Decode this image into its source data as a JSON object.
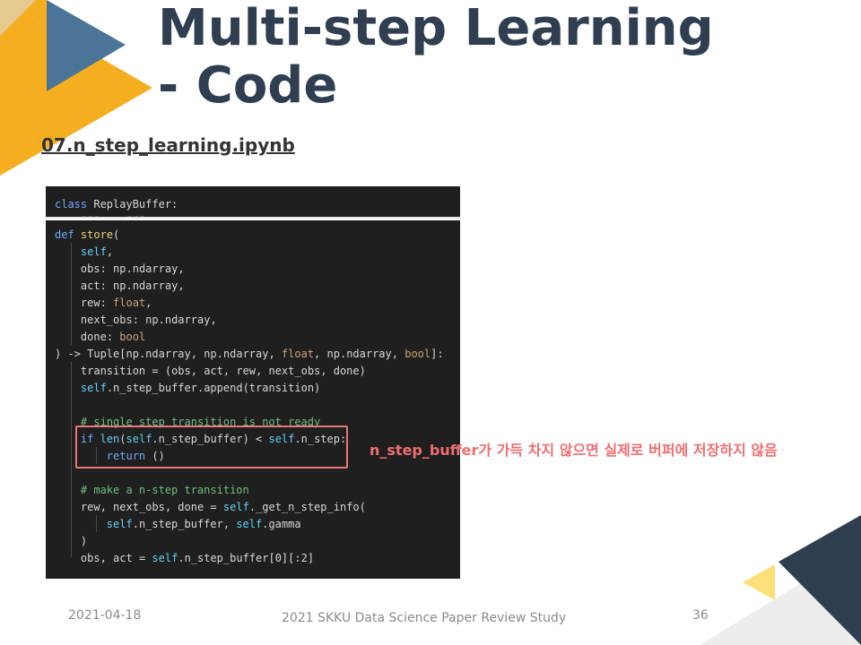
{
  "slide": {
    "title_line1": "Multi-step Learning",
    "title_line2": "- Code",
    "subtitle": "07.n_step_learning.ipynb",
    "annotation": "n_step_buffer가 가득 차지 않으면 실제로 버퍼에 저장하지 않음",
    "footer": {
      "date": "2021-04-18",
      "study": "2021 SKKU Data Science Paper Review Study",
      "page": "36"
    },
    "colors": {
      "title": "#2f3e51",
      "accent_yellow": "#f5ae1f",
      "accent_blue": "#4a7598",
      "dark_navy": "#2f3e51",
      "light_yellow": "#fde07a",
      "highlight": "#ee6e70"
    }
  },
  "code": {
    "class_line": "class ReplayBuffer:",
    "lines": [
      "def store(",
      "    self,",
      "    obs: np.ndarray,",
      "    act: np.ndarray,",
      "    rew: float,",
      "    next_obs: np.ndarray,",
      "    done: bool",
      ") -> Tuple[np.ndarray, np.ndarray, float, np.ndarray, bool]:",
      "    transition = (obs, act, rew, next_obs, done)",
      "    self.n_step_buffer.append(transition)",
      "",
      "    # single step transition is not ready",
      "    if len(self.n_step_buffer) < self.n_step:",
      "        return ()",
      "",
      "    # make a n-step transition",
      "    rew, next_obs, done = self._get_n_step_info(",
      "        self.n_step_buffer, self.gamma",
      "    )",
      "    obs, act = self.n_step_buffer[0][:2]"
    ]
  }
}
